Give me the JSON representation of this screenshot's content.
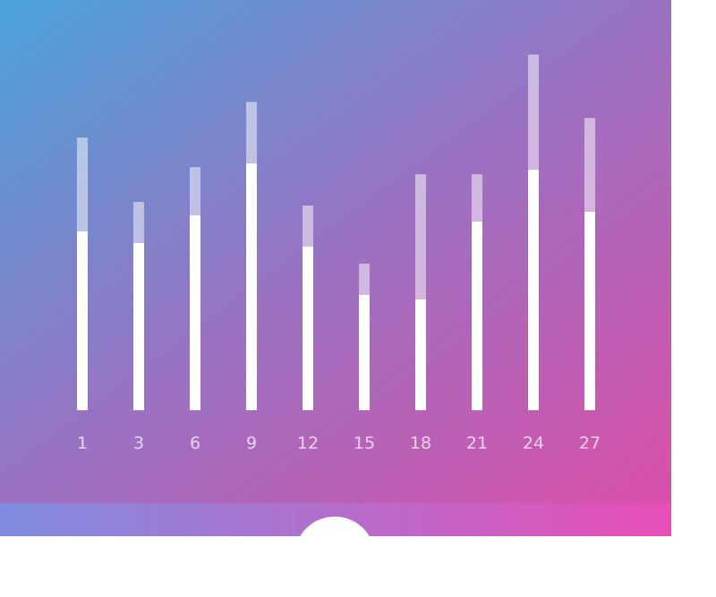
{
  "colors": {
    "gradient_start": "#4aa3da",
    "gradient_mid": "#9a72c2",
    "gradient_end": "#da4fa8",
    "bar_primary": "#ffffff",
    "bar_secondary": "rgba(255,255,255,0.5)",
    "bar_gradient_start": "#7f8cdf",
    "bar_gradient_end": "#e84eb7"
  },
  "chart_data": {
    "type": "bar",
    "stacked": true,
    "categories": [
      "1",
      "3",
      "6",
      "9",
      "12",
      "15",
      "18",
      "21",
      "24",
      "27"
    ],
    "series": [
      {
        "values": [
          200,
          187,
          218,
          276,
          183,
          129,
          124,
          211,
          269,
          222
        ]
      },
      {
        "values": [
          105,
          46,
          54,
          69,
          46,
          35,
          140,
          53,
          129,
          105
        ]
      }
    ],
    "ylim": [
      0,
      400
    ],
    "grid": false,
    "title": "",
    "xlabel": "",
    "ylabel": ""
  }
}
